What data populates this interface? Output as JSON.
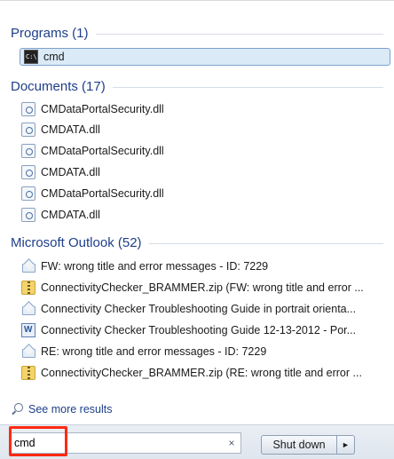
{
  "programs": {
    "header": "Programs (1)",
    "items": [
      {
        "label": "cmd",
        "icon": "cmd-icon"
      }
    ]
  },
  "documents": {
    "header": "Documents (17)",
    "items": [
      {
        "label": "CMDataPortalSecurity.dll",
        "icon": "dll-icon"
      },
      {
        "label": "CMDATA.dll",
        "icon": "dll-icon"
      },
      {
        "label": "CMDataPortalSecurity.dll",
        "icon": "dll-icon"
      },
      {
        "label": "CMDATA.dll",
        "icon": "dll-icon"
      },
      {
        "label": "CMDataPortalSecurity.dll",
        "icon": "dll-icon"
      },
      {
        "label": "CMDATA.dll",
        "icon": "dll-icon"
      }
    ]
  },
  "outlook": {
    "header": "Microsoft Outlook (52)",
    "items": [
      {
        "label": "FW: wrong title and error messages - ID: 7229",
        "icon": "mail-icon"
      },
      {
        "label": "ConnectivityChecker_BRAMMER.zip (FW: wrong title and error ...",
        "icon": "zip-icon"
      },
      {
        "label": "Connectivity Checker Troubleshooting Guide in portrait orienta...",
        "icon": "mail-icon"
      },
      {
        "label": "Connectivity Checker Troubleshooting Guide 12-13-2012  - Por...",
        "icon": "word-icon"
      },
      {
        "label": "RE: wrong title and error messages - ID: 7229",
        "icon": "mail-icon"
      },
      {
        "label": "ConnectivityChecker_BRAMMER.zip (RE: wrong title and error ...",
        "icon": "zip-icon"
      }
    ]
  },
  "see_more": "See more results",
  "search": {
    "value": "cmd",
    "clear_symbol": "×"
  },
  "shutdown": {
    "label": "Shut down",
    "arrow": "►"
  },
  "colors": {
    "highlight": "#ff2a12",
    "header_text": "#1e3f8a"
  }
}
